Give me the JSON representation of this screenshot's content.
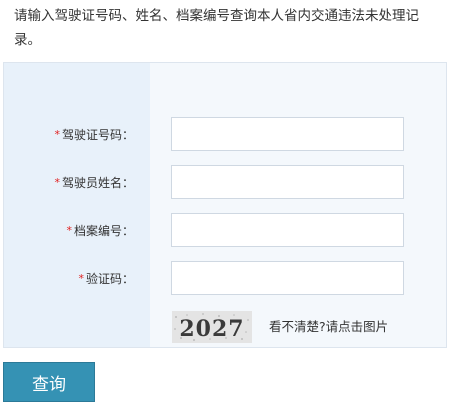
{
  "intro_text": "请输入驾驶证号码、姓名、档案编号查询本人省内交通违法未处理记录。",
  "form": {
    "required_mark": "*",
    "fields": [
      {
        "label": "驾驶证号码：",
        "value": "",
        "placeholder": ""
      },
      {
        "label": "驾驶员姓名：",
        "value": "",
        "placeholder": ""
      },
      {
        "label": "档案编号：",
        "value": "",
        "placeholder": ""
      },
      {
        "label": "验证码：",
        "value": "",
        "placeholder": ""
      }
    ],
    "captcha": {
      "code": "2027",
      "refresh_text": "看不清楚?请点击图片"
    }
  },
  "submit_label": "查询",
  "colors": {
    "label_column_bg": "#e8f1fa",
    "panel_bg": "#f4f8fc",
    "button_bg": "#3592b4",
    "required": "#e02020"
  }
}
